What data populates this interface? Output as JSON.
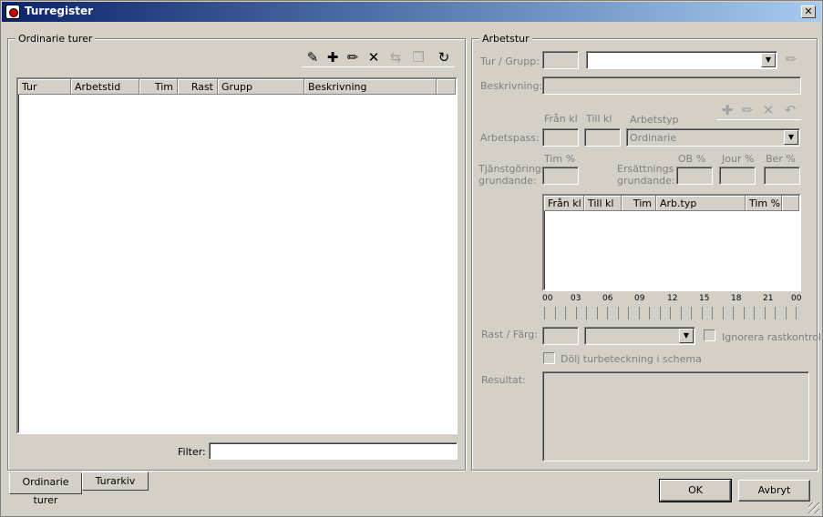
{
  "window": {
    "title": "Turregister",
    "close_glyph": "✕"
  },
  "left": {
    "group_label": "Ordinarie turer",
    "toolbar": [
      "wand-icon",
      "plus-icon",
      "pencil-icon",
      "delete-icon",
      "swap-icon",
      "copy-icon",
      "refresh-icon"
    ],
    "columns": [
      "Tur",
      "Arbetstid",
      "Tim",
      "Rast",
      "Grupp",
      "Beskrivning"
    ],
    "filter_label": "Filter:",
    "filter_value": ""
  },
  "right": {
    "group_label": "Arbetstur",
    "tur_grupp_label": "Tur / Grupp:",
    "beskrivning_label": "Beskrivning:",
    "fran_kl_label": "Från kl",
    "till_kl_label": "Till kl",
    "arbetstyp_label": "Arbetstyp",
    "arbetspass_label": "Arbetspass:",
    "arbetstyp_value": "Ordinarie",
    "tim_pct_label": "Tim %",
    "tjanst_label_1": "Tjänstgörings",
    "tjanst_label_2": "grundande:",
    "ers_label_1": "Ersättnings",
    "ers_label_2": "grundande:",
    "ob_label": "OB %",
    "jour_label": "Jour %",
    "ber_label": "Ber %",
    "pass_columns": [
      "Från kl",
      "Till kl",
      "Tim",
      "Arb.typ",
      "Tim %"
    ],
    "ruler_ticks": [
      "00",
      "03",
      "06",
      "09",
      "12",
      "15",
      "18",
      "21",
      "00"
    ],
    "rast_farg_label": "Rast / Färg:",
    "ignorera_label": "Ignorera rastkontroll",
    "dolj_label": "Dölj turbeteckning i schema",
    "resultat_label": "Resultat:"
  },
  "tabs": [
    "Ordinarie turer",
    "Turarkiv"
  ],
  "buttons": {
    "ok": "OK",
    "cancel": "Avbryt"
  }
}
